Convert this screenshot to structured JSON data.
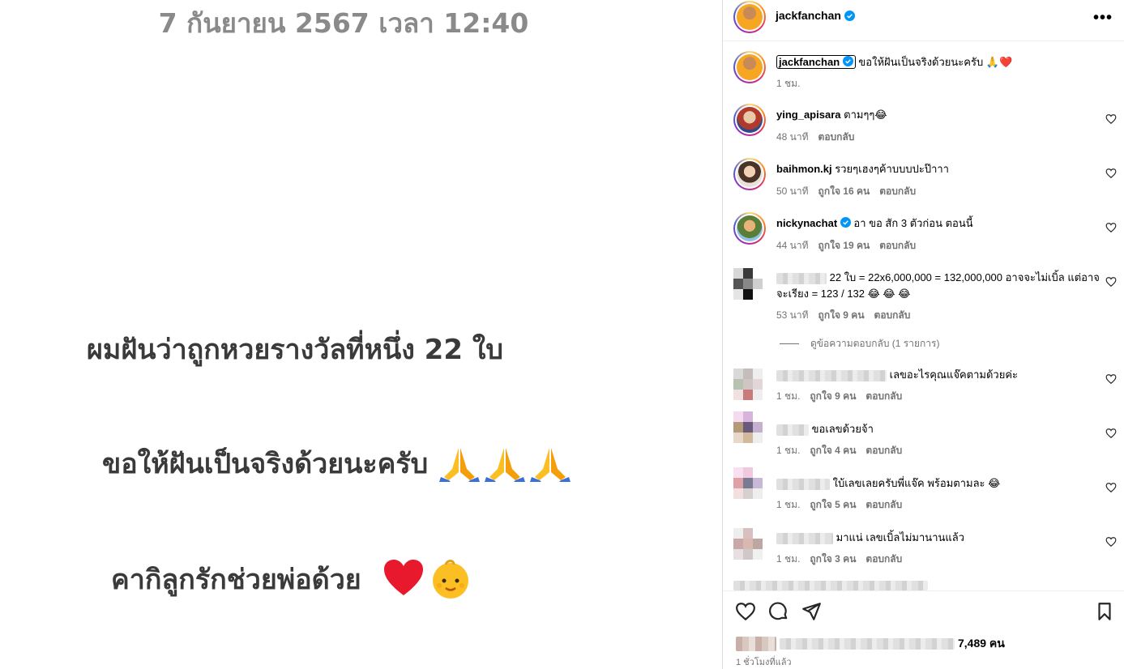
{
  "post": {
    "date_text": "7 กันยายน 2567 เวลา 12:40",
    "line1": "ผมฝันว่าถูกหวยรางวัลที่หนึ่ง 22 ใบ",
    "line2": "ขอให้ฝันเป็นจริงด้วยนะครับ",
    "line3": "คากิลูกรักช่วยพ่อด้วย"
  },
  "header": {
    "username": "jackfanchan",
    "more_label": "•••"
  },
  "caption": {
    "username": "jackfanchan",
    "text": "ขอให้ฝันเป็นจริงด้วยนะครับ 🙏❤️",
    "time": "1 ชม."
  },
  "comments": [
    {
      "user": "ying_apisara",
      "text": "ตามๆๆ😂",
      "time": "48 นาที",
      "likes": "",
      "reply": "ตอบกลับ"
    },
    {
      "user": "baihmon.kj",
      "text": "รวยๆเฮงๆค้าบบบปะป๊าาา",
      "time": "50 นาที",
      "likes": "ถูกใจ 16 คน",
      "reply": "ตอบกลับ"
    },
    {
      "user": "nickynachat",
      "text": "อา ขอ สัก 3 ตัวก่อน ตอนนี้",
      "time": "44 นาที",
      "likes": "ถูกใจ 19 คน",
      "reply": "ตอบกลับ"
    },
    {
      "user": "",
      "text": "22 ใบ = 22x6,000,000 = 132,000,000 อาจจะไม่เบิ้ล แต่อาจจะเรียง = 123 / 132 😂 😂 😂",
      "time": "53 นาที",
      "likes": "ถูกใจ 9 คน",
      "reply": "ตอบกลับ"
    },
    {
      "user": "",
      "text": "เลขอะไรคุณแจ๊คตามด้วยค่ะ",
      "time": "1 ชม.",
      "likes": "ถูกใจ 9 คน",
      "reply": "ตอบกลับ"
    },
    {
      "user": "",
      "text": "ขอเลขด้วยจ้า",
      "time": "1 ชม.",
      "likes": "ถูกใจ 4 คน",
      "reply": "ตอบกลับ"
    },
    {
      "user": "",
      "text": "ใบ้เลขเลยครับพี่แจ๊ค พร้อมตามละ 😂",
      "time": "1 ชม.",
      "likes": "ถูกใจ 5 คน",
      "reply": "ตอบกลับ"
    },
    {
      "user": "",
      "text": "มาแน่ เลขเบิ้ลไม่มานานแล้ว",
      "time": "1 ชม.",
      "likes": "ถูกใจ 3 คน",
      "reply": "ตอบกลับ"
    }
  ],
  "view_replies": "ดูข้อความตอบกลับ (1 รายการ)",
  "footer": {
    "likes_count": "7,489 คน",
    "time_ago": "1 ชั่วโมงที่แล้ว"
  },
  "colors": {
    "verified": "#0095f6",
    "heart": "#ff3040",
    "meta": "#737373"
  }
}
